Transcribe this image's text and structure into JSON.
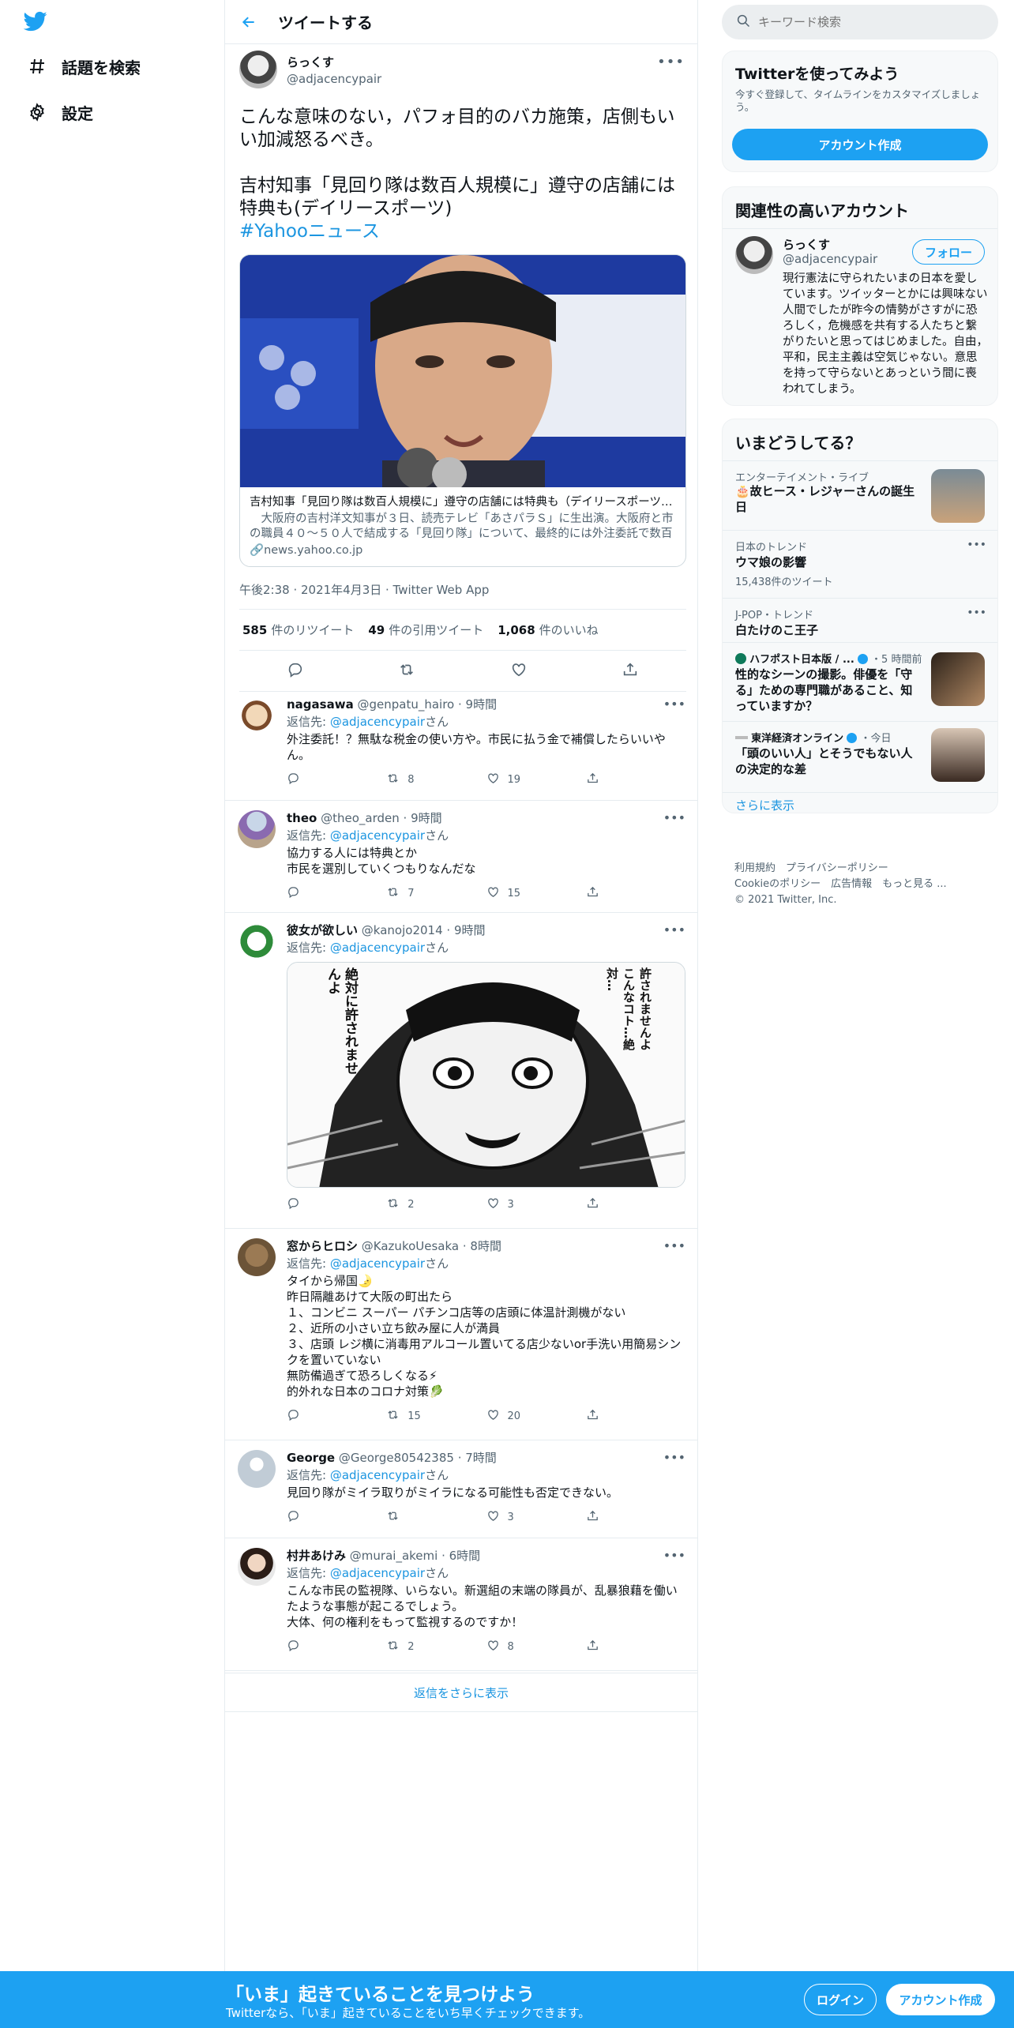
{
  "nav": {
    "items": [
      {
        "label": "話題を検索"
      },
      {
        "label": "設定"
      }
    ]
  },
  "header": {
    "title": "ツイートする"
  },
  "tweet": {
    "name": "らっくす",
    "handle": "@adjacencypair",
    "text1": "こんな意味のない，パフォ目的のバカ施策，店側もいい加減怒るべき。",
    "text2": "吉村知事「見回り隊は数百人規模に」遵守の店舗には特典も(デイリースポーツ)",
    "hashtag": "#Yahooニュース",
    "card": {
      "title": "吉村知事「見回り隊は数百人規模に」遵守の店舗には特典も（デイリースポーツ） - Yahoo!ニュース",
      "description": "　大阪府の吉村洋文知事が３日、読売テレビ「あさパラＳ」に生出演。大阪府と市の職員４０～５０人で結成する「見回り隊」について、最終的には外注委託で数百人規模になることを明かした。",
      "domain": "news.yahoo.co.jp"
    },
    "meta": "午後2:38 · 2021年4月3日 · Twitter Web App",
    "stats": [
      {
        "count": "585",
        "label": "件のリツイート"
      },
      {
        "count": "49",
        "label": "件の引用ツイート"
      },
      {
        "count": "1,068",
        "label": "件のいいね"
      }
    ]
  },
  "replies": [
    {
      "name": "nagasawa",
      "handle": "@genpatu_hairo",
      "time": "9時間",
      "reply_to_prefix": "返信先: ",
      "reply_to": "@adjacencypair",
      "reply_to_suffix": "さん",
      "text": "外注委託！？無駄な税金の使い方や。市民に払う金で補償したらいいやん。",
      "retweets": "8",
      "likes": "19"
    },
    {
      "name": "theo",
      "handle": "@theo_arden",
      "time": "9時間",
      "reply_to_prefix": "返信先: ",
      "reply_to": "@adjacencypair",
      "reply_to_suffix": "さん",
      "text": "協力する人には特典とか\n市民を選別していくつもりなんだな",
      "retweets": "7",
      "likes": "15"
    },
    {
      "name": "彼女が欲しい",
      "handle": "@kanojo2014",
      "time": "9時間",
      "reply_to_prefix": "返信先: ",
      "reply_to": "@adjacencypair",
      "reply_to_suffix": "さん",
      "text": "",
      "manga_left": "絶対に許されませんよ",
      "manga_right": "許されませんよこんなコト…絶対…",
      "retweets": "2",
      "likes": "3"
    },
    {
      "name": "窓からヒロシ",
      "handle": "@KazukoUesaka",
      "time": "8時間",
      "reply_to_prefix": "返信先: ",
      "reply_to": "@adjacencypair",
      "reply_to_suffix": "さん",
      "text": "タイから帰国🌛\n昨日隔離あけて大阪の町出たら\n１、コンビニ スーパー パチンコ店等の店頭に体温計測機がない\n２、近所の小さい立ち飲み屋に人が満員\n３、店頭 レジ横に消毒用アルコール置いてる店少ないor手洗い用簡易シンクを置いていない\n無防備過ぎて恐ろしくなる⚡\n的外れな日本のコロナ対策🥬",
      "retweets": "15",
      "likes": "20"
    },
    {
      "name": "George",
      "handle": "@George80542385",
      "time": "7時間",
      "reply_to_prefix": "返信先: ",
      "reply_to": "@adjacencypair",
      "reply_to_suffix": "さん",
      "text": "見回り隊がミイラ取りがミイラになる可能性も否定できない。",
      "retweets": "",
      "likes": "3"
    },
    {
      "name": "村井あけみ",
      "handle": "@murai_akemi",
      "time": "6時間",
      "reply_to_prefix": "返信先: ",
      "reply_to": "@adjacencypair",
      "reply_to_suffix": "さん",
      "text": "こんな市民の監視隊、いらない。新選組の末端の隊員が、乱暴狼藉を働いたような事態が起こるでしょう。\n大体、何の権利をもって監視するのですか！",
      "retweets": "2",
      "likes": "8"
    }
  ],
  "more_replies": "返信をさらに表示",
  "search": {
    "placeholder": "キーワード検索"
  },
  "signup": {
    "title": "Twitterを使ってみよう",
    "subtitle": "今すぐ登録して、タイムラインをカスタマイズしましょう。",
    "button": "アカウント作成"
  },
  "related": {
    "title": "関連性の高いアカウント",
    "name": "らっくす",
    "handle": "@adjacencypair",
    "follow": "フォロー",
    "bio": "現行憲法に守られたいまの日本を愛しています。ツイッターとかには興味ない人間でしたが昨今の情勢がさすがに恐ろしく，危機感を共有する人たちと繋がりたいと思ってはじめました。自由，平和，民主主義は空気じゃない。意思を持って守らないとあっという間に喪われてしまう。"
  },
  "trends": {
    "title": "いまどうしてる？",
    "items": [
      {
        "context": "エンターテイメント・ライブ",
        "name": "🎂故ヒース・レジャーさんの誕生日"
      },
      {
        "context": "日本のトレンド",
        "name": "ウマ娘の影響",
        "count": "15,438件のツイート"
      },
      {
        "context": "J-POP・トレンド",
        "name": "白たけのこ王子"
      },
      {
        "context": "ハフポスト日本版 / ...",
        "time": "・5 時間前",
        "name": "性的なシーンの撮影。俳優を「守る」ための専門職があること、知っていますか？"
      },
      {
        "context": "東洋経済オンライン",
        "time": "・今日",
        "name": "「頭のいい人」とそうでもない人の決定的な差"
      }
    ],
    "show_more": "さらに表示"
  },
  "footer": {
    "line1": "利用規約　プライバシーポリシー",
    "line2": "Cookieのポリシー　広告情報　もっと見る ...",
    "line3": "© 2021 Twitter, Inc."
  },
  "bottom": {
    "title": "「いま」起きていることを見つけよう",
    "subtitle": "Twitterなら、「いま」起きていることをいち早くチェックできます。",
    "login": "ログイン",
    "signup": "アカウント作成"
  },
  "colors": {
    "accent": "#1da1f2",
    "link": "#1b95e0",
    "muted": "#536471",
    "border": "#e6ecf0"
  }
}
